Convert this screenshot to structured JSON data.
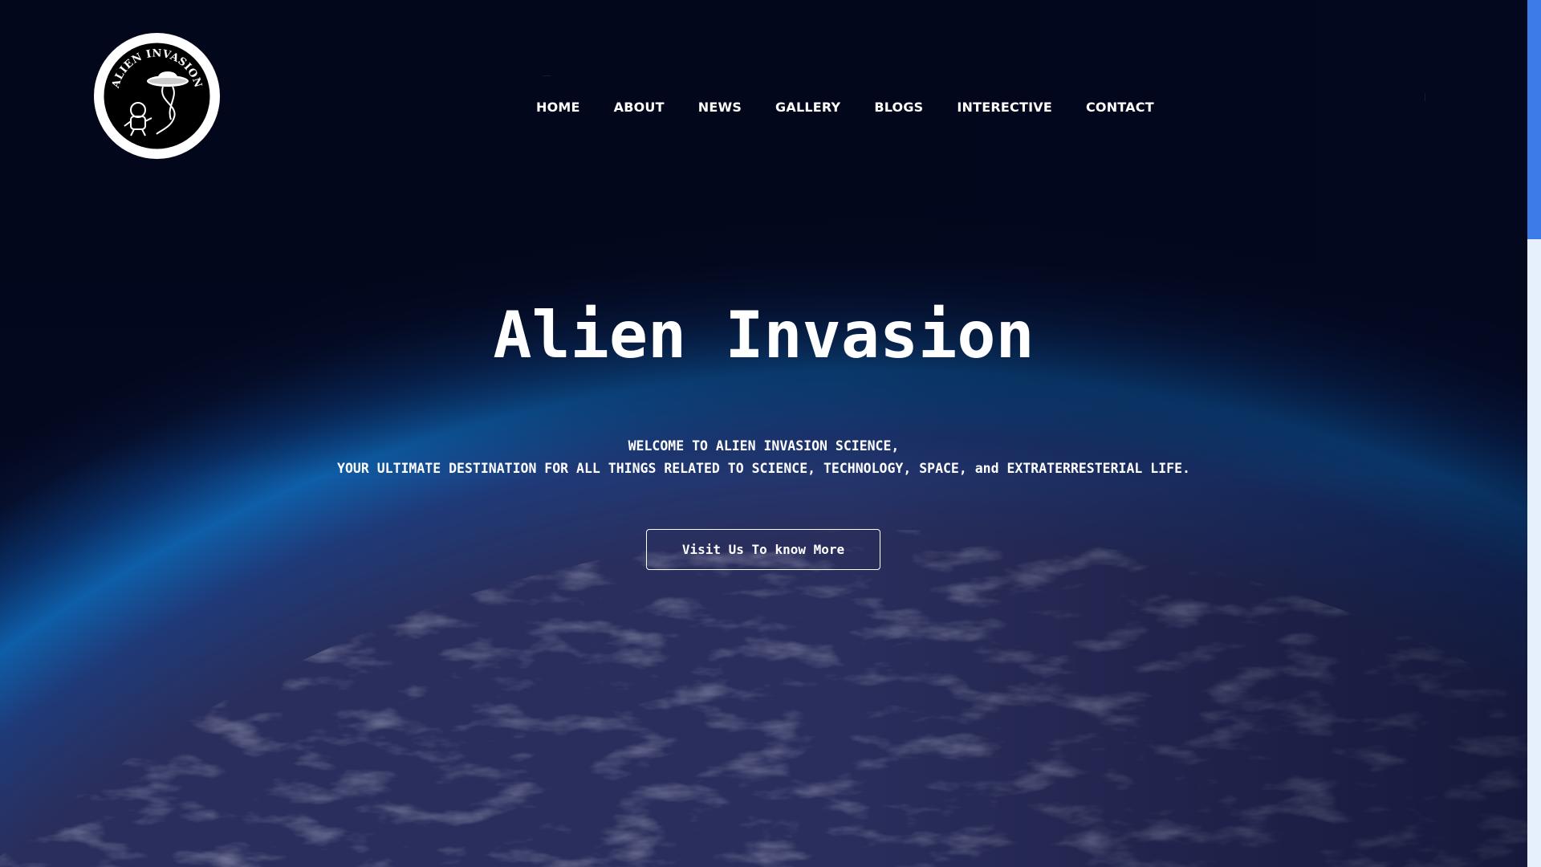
{
  "logo": {
    "text": "ALIEN INVASION",
    "icon": "ufo-astronaut-logo-icon"
  },
  "nav": {
    "items": [
      {
        "label": "HOME"
      },
      {
        "label": "ABOUT"
      },
      {
        "label": "NEWS"
      },
      {
        "label": "GALLERY"
      },
      {
        "label": "BLOGS"
      },
      {
        "label": "INTERECTIVE"
      },
      {
        "label": "CONTACT"
      }
    ]
  },
  "hero": {
    "title": "Alien Invasion",
    "subtitle_line1": "WELCOME TO ALIEN INVASION SCIENCE,",
    "subtitle_line2": "YOUR ULTIMATE DESTINATION FOR ALL THINGS RELATED TO SCIENCE, TECHNOLOGY, SPACE, and EXTRATERRESTERIAL LIFE.",
    "cta_label": "Visit Us To know More",
    "background": "earth-from-space-image"
  },
  "colors": {
    "background_dark": "#040820",
    "atmosphere_blue": "#0d5fae",
    "text": "#ffffff",
    "scrollbar_track": "#e6f0fd",
    "scrollbar_thumb": "#3d7ce8"
  }
}
